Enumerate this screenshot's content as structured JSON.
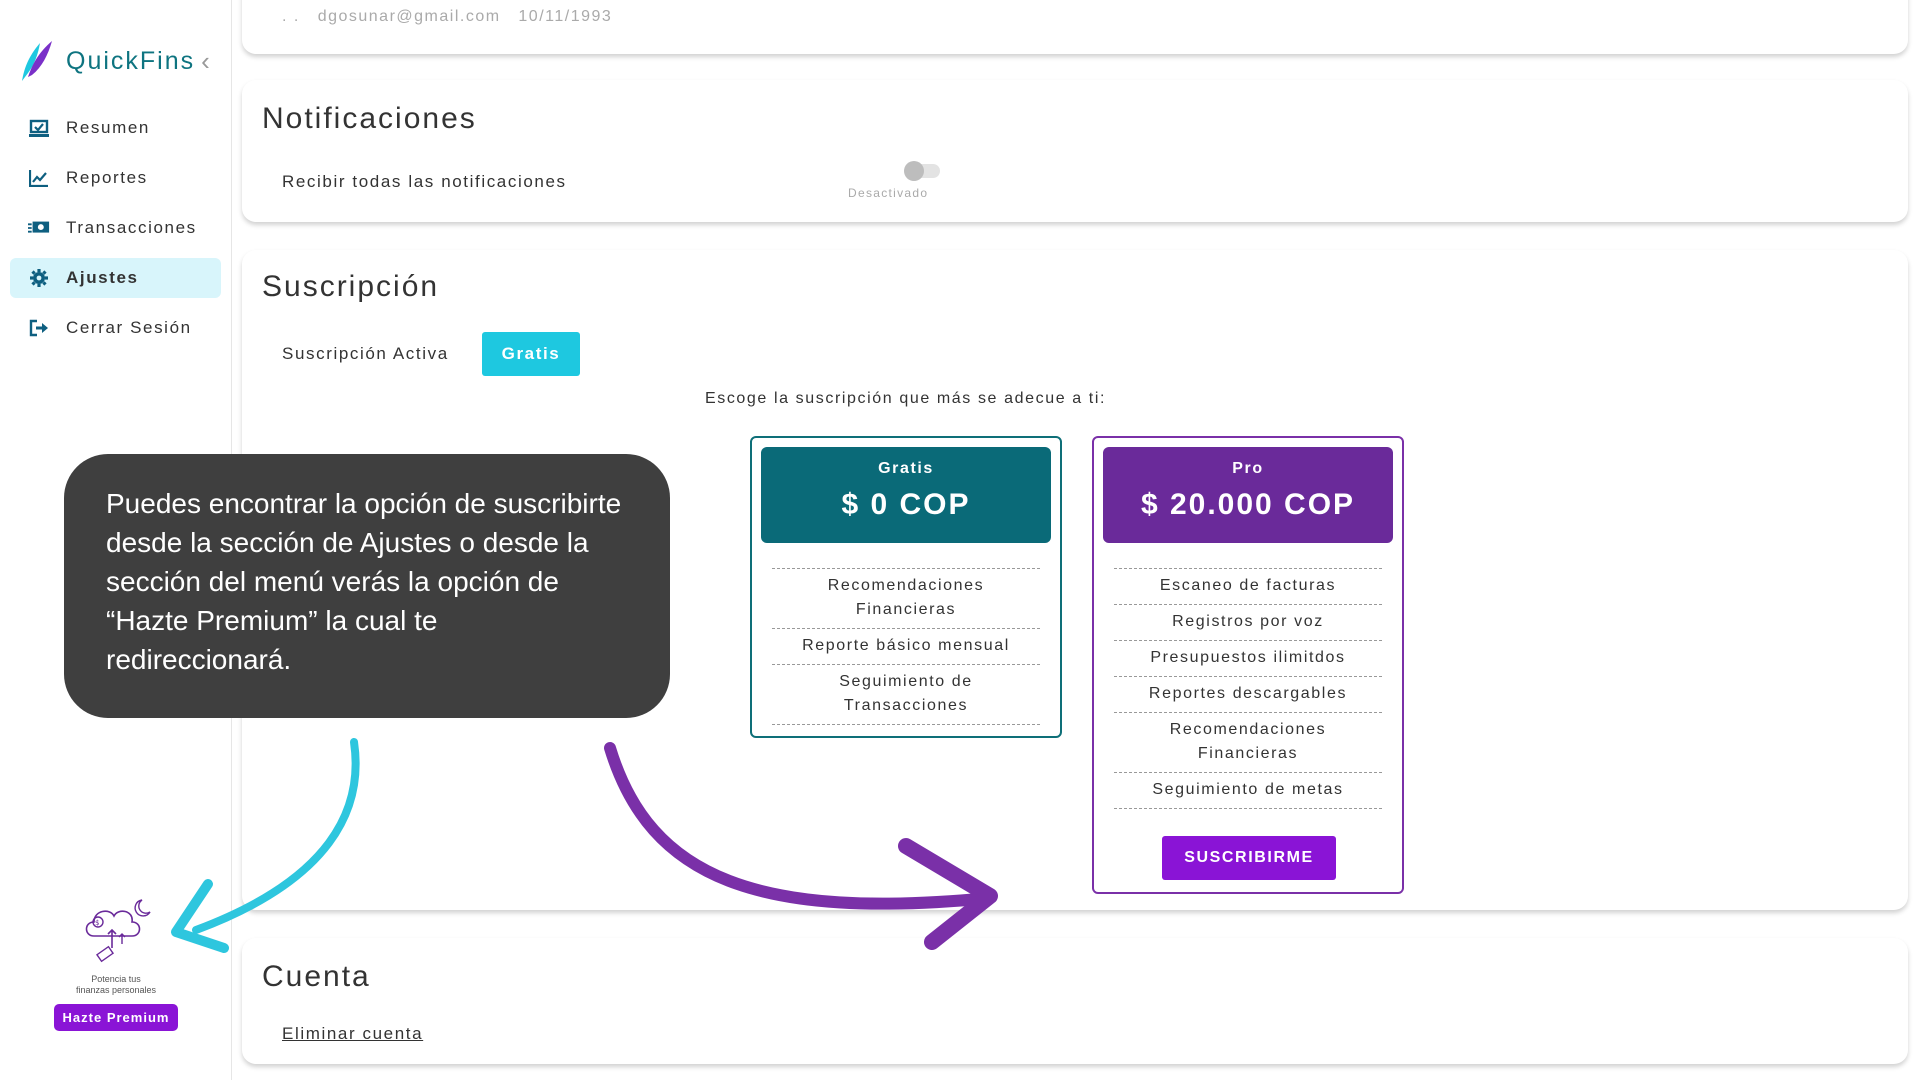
{
  "brand": {
    "name": "QuickFins",
    "collapse_glyph": "‹"
  },
  "sidebar": {
    "items": [
      {
        "label": "Resumen",
        "icon": "summary-icon",
        "active": false
      },
      {
        "label": "Reportes",
        "icon": "chart-icon",
        "active": false
      },
      {
        "label": "Transacciones",
        "icon": "money-icon",
        "active": false
      },
      {
        "label": "Ajustes",
        "icon": "gear-icon",
        "active": true
      },
      {
        "label": "Cerrar Sesión",
        "icon": "logout-icon",
        "active": false
      }
    ],
    "promo": {
      "caption_line1": "Potencia tus",
      "caption_line2": "finanzas personales",
      "button_label": "Hazte Premium"
    }
  },
  "profile": {
    "prefix": ". .",
    "email": "dgosunar@gmail.com",
    "birthdate": "10/11/1993"
  },
  "notifications": {
    "title": "Notificaciones",
    "label": "Recibir todas las notificaciones",
    "toggle_state": "Desactivado",
    "enabled": false
  },
  "subscription": {
    "title": "Suscripción",
    "active_label": "Suscripción Activa",
    "active_plan": "Gratis",
    "prompt": "Escoge la suscripción que más se adecue a ti:",
    "plans": [
      {
        "name": "Gratis",
        "price": "$ 0 COP",
        "features": [
          "Recomendaciones Financieras",
          "Reporte básico mensual",
          "Seguimiento de Transacciones"
        ]
      },
      {
        "name": "Pro",
        "price": "$ 20.000 COP",
        "features": [
          "Escaneo de facturas",
          "Registros por voz",
          "Presupuestos ilimitdos",
          "Reportes descargables",
          "Recomendaciones Financieras",
          "Seguimiento de metas"
        ],
        "button_label": "SUSCRIBIRME"
      }
    ]
  },
  "account": {
    "title": "Cuenta",
    "delete_label": "Eliminar cuenta"
  },
  "callout": {
    "text": "Puedes encontrar la opción de suscribirte desde la sección de Ajustes o desde la sección del menú verás la opción de “Hazte Premium” la cual te redireccionará."
  },
  "colors": {
    "teal": "#0a6a78",
    "cyan": "#1ec8e0",
    "purple": "#8a14d6",
    "pro_header": "#6a2a9a",
    "callout_bg": "#3f3f3f",
    "active_nav_bg": "#d8f5fb"
  }
}
